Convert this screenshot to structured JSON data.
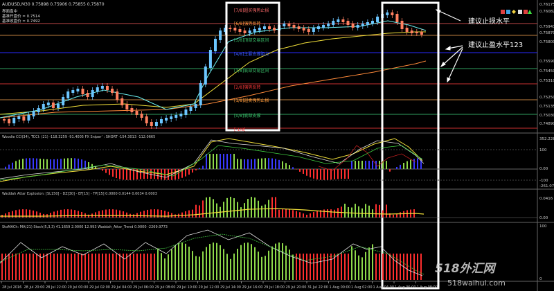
{
  "main_chart": {
    "symbol_label": "AUDUSD,M30  0.75898 0.75906 0.75855 0.75870",
    "info_lines": [
      "界面盘中",
      "基准开盘价 = 0.7514",
      "基准收盘价 = 0.7492"
    ],
    "level_labels": [
      {
        "text": "[7/8]超买强势止损",
        "color": "#ff6a6a"
      },
      {
        "text": "[6/8]强势反转",
        "color": "#ff9a3a"
      },
      {
        "text": "[5/8]顶部交易区间",
        "color": "#3ac06a"
      },
      {
        "text": "[4/8]主要支撑阻力",
        "color": "#3a5aff"
      },
      {
        "text": "[3/8]底部交易区间",
        "color": "#3ac06a"
      },
      {
        "text": "[2/8]强势反转",
        "color": "#ff3a3a"
      },
      {
        "text": "[1/8]超卖强势止损",
        "color": "#ff9a3a"
      },
      {
        "text": "[0/8]底部支撑",
        "color": "#3ac06a"
      },
      {
        "text": "[-1/8]",
        "color": "#ff3a3a"
      }
    ],
    "price_axis": [
      "0.76175",
      "0.76082",
      "0.75943",
      "0.75870",
      "0.75800",
      "0.75590",
      "0.75450",
      "0.75310",
      "0.75250",
      "0.75135",
      "0.75030",
      "0.74890"
    ],
    "annotation_stop": "建议止损水平",
    "annotation_tp": "建议止盈水平123"
  },
  "cci_panel": {
    "label": "Woodie CCI(34), TCCI: (21) -118.3259 -91.4005  FX Sniper' : SHORT -154.3013 -112.0665",
    "axis": [
      "352.228",
      "100",
      "0.00",
      "-100",
      "-261.0706"
    ]
  },
  "waddah_panel": {
    "label": "Waddah Attar Explosion: [SL150] - DZ[30] - EF[15] - TP[15] 0.0000 0.0144 0.0034 0.0003",
    "axis": [
      "0.0416",
      "0.00"
    ]
  },
  "stoch_panel": {
    "label": "StoMACh: MA(21)  Stoch(5,3,3) 41.1659  2.0000 12.993  Waddah_Attar_Trend 0.0000 -2269.9773",
    "axis": [
      "100",
      "0"
    ]
  },
  "time_axis": [
    "28 Jul 2016",
    "28 Jul 20:00",
    "28 Jul 22:00",
    "29 Jul 00:00",
    "29 Jul 02:00",
    "29 Jul 04:00",
    "29 Jul 06:00",
    "29 Jul 08:00",
    "29 Jul 10:00",
    "29 Jul 12:00",
    "29 Jul 14:00",
    "29 Jul 16:00",
    "29 Jul 18:00",
    "29 Jul 20:00",
    "31 Jul 22:00",
    "1 Aug 00:00",
    "1 Aug 02:00",
    "1 Aug 04:00",
    "1 Aug 06:00",
    "1 Aug 08:00"
  ],
  "watermark": {
    "top": "518外汇网",
    "bottom": "518waihui.com"
  },
  "colors": {
    "bull": "#6cc6ff",
    "bear": "#ff8060",
    "hist_up": "#8ed94a",
    "hist_down": "#ff2e2e"
  }
}
